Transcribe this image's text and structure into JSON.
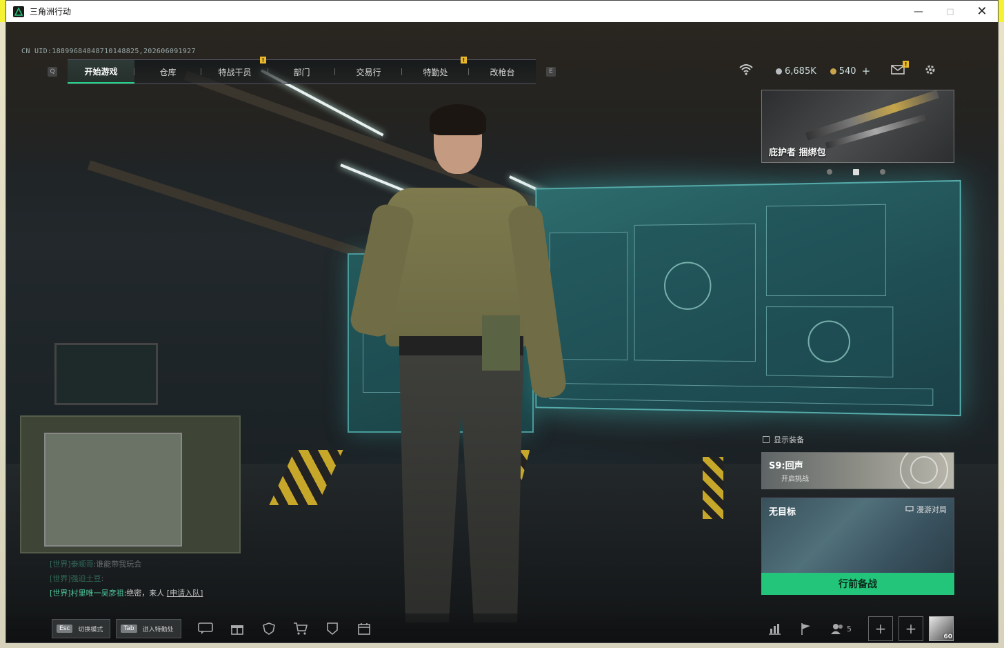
{
  "window": {
    "title": "三角洲行动"
  },
  "hud": {
    "uid": "CN UID:18899684848710148825,202606091927"
  },
  "nav": {
    "left_key": "Q",
    "right_key": "E",
    "tabs": [
      {
        "label": "开始游戏",
        "active": true,
        "badge": ""
      },
      {
        "label": "仓库",
        "active": false,
        "badge": ""
      },
      {
        "label": "特战干员",
        "active": false,
        "badge": "!"
      },
      {
        "label": "部门",
        "active": false,
        "badge": ""
      },
      {
        "label": "交易行",
        "active": false,
        "badge": ""
      },
      {
        "label": "特勤处",
        "active": false,
        "badge": "!"
      },
      {
        "label": "改枪台",
        "active": false,
        "badge": ""
      }
    ]
  },
  "status": {
    "currency_silver": "6,685K",
    "currency_gold": "540",
    "add_label": "+",
    "mail_badge": "!",
    "icons": [
      "wifi-icon",
      "mail-icon",
      "gear-icon"
    ]
  },
  "promo": {
    "label": "庇护者 捆绑包",
    "active_dot": 1,
    "dot_count": 3
  },
  "show_equipment_label": "显示装备",
  "season": {
    "title": "S9:回声",
    "subtitle": "开启挑战"
  },
  "mode": {
    "title": "无目标",
    "tag": "漫游对局"
  },
  "start_button": "行前备战",
  "chat": [
    {
      "channel": "[世界]",
      "name": "泰顺哥",
      "text": ":谁能带我玩会",
      "dim": true
    },
    {
      "channel": "[世界]",
      "name": "强迫土豆",
      "text": ":",
      "dim": true
    },
    {
      "channel": "[世界]",
      "name": "村里唯一吴彦祖",
      "text": ":绝密，来人",
      "link": "[申请入队]",
      "dim": false
    }
  ],
  "bottom": {
    "esc_key": "Esc",
    "esc_label": "切换模式",
    "tab_key": "Tab",
    "tab_label": "进入特勤处",
    "icons": [
      "chat-icon",
      "gift-icon",
      "shield-icon",
      "cart-icon",
      "badge-icon",
      "calendar-icon"
    ],
    "right_icons": [
      "stats-icon",
      "flag-icon",
      "friends-icon"
    ],
    "friends_count": "5",
    "avatar_level": "60"
  },
  "colors": {
    "accent": "#23c57a",
    "badge": "#e9b92a",
    "screen": "#2d6c6d"
  }
}
